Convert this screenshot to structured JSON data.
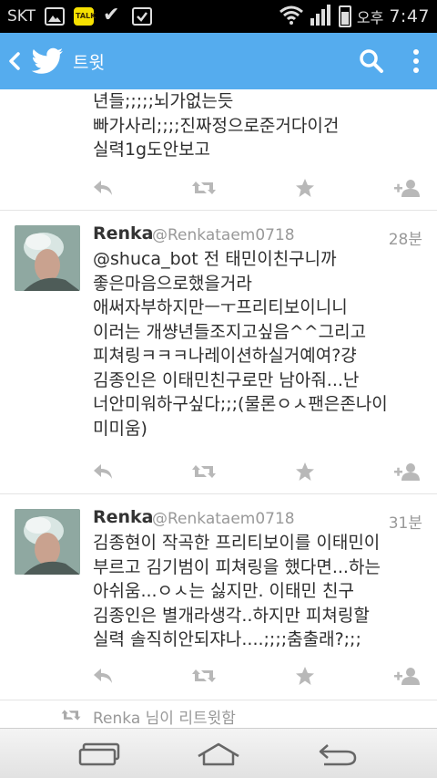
{
  "status_bar": {
    "carrier": "SKT",
    "ampm": "오후",
    "time": "7:47"
  },
  "app_bar": {
    "title": "트윗",
    "accent": "#55acee"
  },
  "tweets": [
    {
      "body": "년들;;;;;뇌가없는듯\n빠가사리;;;;진짜정으로준거다이건\n실력1g도안보고"
    },
    {
      "name": "Renka",
      "handle": "@Renkataem0718",
      "time": "28분",
      "body": "@shuca_bot 전 태민이친구니까\n좋은마음으로했을거라\n애써자부하지만ㅡㅜ프리티보이니니\n이러는 개썅년들조지고싶음^^그리고\n피쳐링ㅋㅋㅋ나레이션하실거예여?걍\n김종인은 이태민친구로만 남아줘...난\n너안미워하구싶다;;;(물론ㅇㅅ팬은존나이\n미미움)"
    },
    {
      "name": "Renka",
      "handle": "@Renkataem0718",
      "time": "31분",
      "body": "김종현이 작곡한 프리티보이를 이태민이\n부르고 김기범이 피쳐링을 했다면...하는\n아쉬움...ㅇㅅ는 싫지만. 이태민 친구\n김종인은 별개라생각..하지만 피쳐링할\n실력 솔직히안되쟈나....;;;;춤출래?;;;"
    }
  ],
  "retweet_note": "Renka 님이 리트윗함",
  "icons": [
    "reply-icon",
    "retweet-icon",
    "favorite-icon",
    "follow-icon"
  ]
}
